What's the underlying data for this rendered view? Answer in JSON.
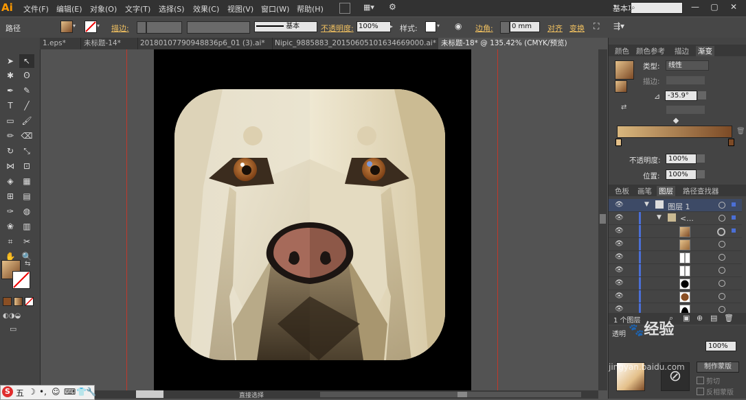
{
  "app": {
    "logo": "Ai"
  },
  "menu": [
    "文件(F)",
    "编辑(E)",
    "对象(O)",
    "文字(T)",
    "选择(S)",
    "效果(C)",
    "视图(V)",
    "窗口(W)",
    "帮助(H)"
  ],
  "workspace": "基本功能",
  "control": {
    "object_type": "路径",
    "stroke_label": "描边:",
    "stroke_style": "基本",
    "opacity_label": "不透明度:",
    "opacity_value": "100%",
    "style_label": "样式:",
    "corner_label": "边角:",
    "corner_value": "0 mm",
    "align_label": "对齐",
    "transform_label": "变换"
  },
  "tabs": [
    {
      "label": "1.eps*"
    },
    {
      "label": "未标题-14*"
    },
    {
      "label": "20180107790948836p6_01 (3).ai*"
    },
    {
      "label": "Nipic_9885883_20150605101634669000.ai*"
    },
    {
      "label": "未标题-18* @ 135.42% (CMYK/预览)"
    }
  ],
  "status": {
    "mode": "直接选择"
  },
  "gradient_panel": {
    "tabs": [
      "颜色",
      "颜色参考",
      "描边",
      "渐变"
    ],
    "type_label": "类型:",
    "type_value": "线性",
    "stroke_label": "描边:",
    "angle_value": "-35.9°",
    "opacity_label": "不透明度:",
    "opacity_value": "100%",
    "location_label": "位置:",
    "location_value": "100%"
  },
  "layers_panel": {
    "tabs": [
      "色板",
      "画笔",
      "图层",
      "路径查找器"
    ],
    "layer_name": "图层 1",
    "group_name": "<...",
    "footer": "1 个图层"
  },
  "bottom_panel": {
    "tab": "透明",
    "opacity_value": "100%",
    "make_mask": "制作蒙版",
    "clip": "剪切",
    "invert": "反相蒙版"
  },
  "watermark": {
    "logo_text": "经验",
    "site_text": "jingyan.baidu.com"
  },
  "colors": {
    "gradient_start": "#d9b77e",
    "gradient_end": "#7c4a26",
    "accent_link": "#f0c060"
  }
}
